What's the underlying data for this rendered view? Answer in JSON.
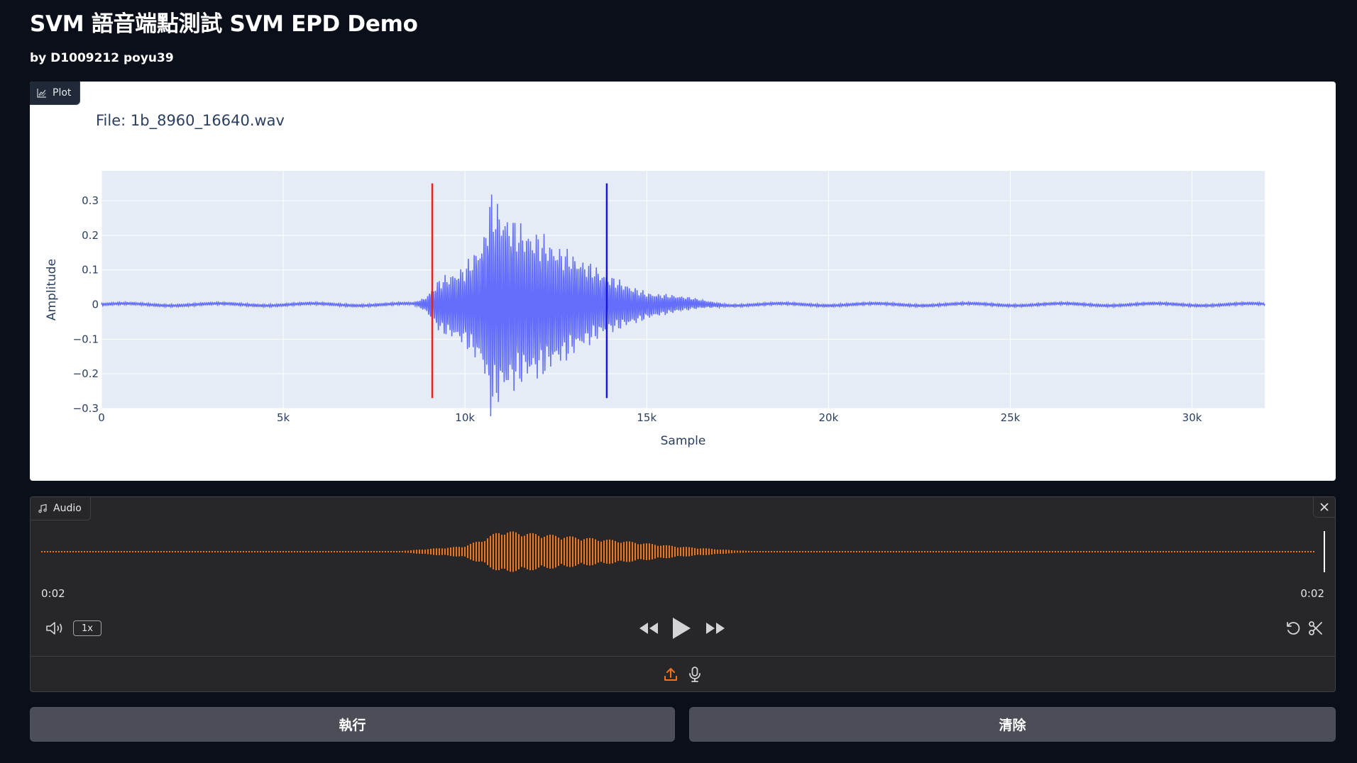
{
  "header": {
    "title": "SVM 語音端點測試 SVM EPD Demo",
    "subtitle": "by D1009212 poyu39"
  },
  "plot_panel": {
    "tag_label": "Plot",
    "tag_icon": "chart-icon"
  },
  "chart_data": {
    "type": "line",
    "title": "File: 1b_8960_16640.wav",
    "xlabel": "Sample",
    "ylabel": "Amplitude",
    "xlim": [
      0,
      32000
    ],
    "ylim": [
      -0.3,
      0.35
    ],
    "x_ticks": [
      {
        "v": 0,
        "label": "0"
      },
      {
        "v": 5000,
        "label": "5k"
      },
      {
        "v": 10000,
        "label": "10k"
      },
      {
        "v": 15000,
        "label": "15k"
      },
      {
        "v": 20000,
        "label": "20k"
      },
      {
        "v": 25000,
        "label": "25k"
      },
      {
        "v": 30000,
        "label": "30k"
      }
    ],
    "y_ticks": [
      {
        "v": 0.3,
        "label": "0.3"
      },
      {
        "v": 0.2,
        "label": "0.2"
      },
      {
        "v": 0.1,
        "label": "0.1"
      },
      {
        "v": 0,
        "label": "0"
      },
      {
        "v": -0.1,
        "label": "−0.1"
      },
      {
        "v": -0.2,
        "label": "−0.2"
      },
      {
        "v": -0.3,
        "label": "−0.3"
      }
    ],
    "grid": true,
    "series": [
      {
        "color": "#636efa",
        "envelope": [
          {
            "x": 0,
            "amp": 0.004
          },
          {
            "x": 8600,
            "amp": 0.004
          },
          {
            "x": 8900,
            "amp": 0.02
          },
          {
            "x": 9300,
            "amp": 0.08
          },
          {
            "x": 10000,
            "amp": 0.12
          },
          {
            "x": 10500,
            "amp": 0.2
          },
          {
            "x": 10700,
            "amp": 0.33
          },
          {
            "x": 11000,
            "amp": 0.29
          },
          {
            "x": 11500,
            "amp": 0.24
          },
          {
            "x": 12000,
            "amp": 0.22
          },
          {
            "x": 13000,
            "amp": 0.15
          },
          {
            "x": 13900,
            "amp": 0.09
          },
          {
            "x": 15000,
            "amp": 0.04
          },
          {
            "x": 16700,
            "amp": 0.01
          },
          {
            "x": 17200,
            "amp": 0.004
          },
          {
            "x": 32000,
            "amp": 0.004
          }
        ]
      }
    ],
    "markers": [
      {
        "x": 9100,
        "y_range": [
          -0.27,
          0.35
        ],
        "color": "#e02424"
      },
      {
        "x": 13900,
        "y_range": [
          -0.27,
          0.35
        ],
        "color": "#1515e6"
      }
    ]
  },
  "audio_panel": {
    "tag_label": "Audio",
    "tag_icon": "music-note-icon",
    "current_time": "0:02",
    "duration": "0:02",
    "playback_rate": "1x",
    "waveform_color": "#f97316",
    "waveform_envelope": [
      {
        "t": 0.0,
        "amp": 0.02
      },
      {
        "t": 0.28,
        "amp": 0.02
      },
      {
        "t": 0.3,
        "amp": 0.12
      },
      {
        "t": 0.33,
        "amp": 0.25
      },
      {
        "t": 0.345,
        "amp": 0.55
      },
      {
        "t": 0.33,
        "amp": 0.25
      },
      {
        "t": 0.36,
        "amp": 1.0
      },
      {
        "t": 0.4,
        "amp": 0.8
      },
      {
        "t": 0.45,
        "amp": 0.55
      },
      {
        "t": 0.5,
        "amp": 0.25
      },
      {
        "t": 0.54,
        "amp": 0.08
      },
      {
        "t": 0.56,
        "amp": 0.02
      },
      {
        "t": 1.0,
        "amp": 0.02
      }
    ]
  },
  "actions": {
    "run_label": "執行",
    "clear_label": "清除"
  }
}
